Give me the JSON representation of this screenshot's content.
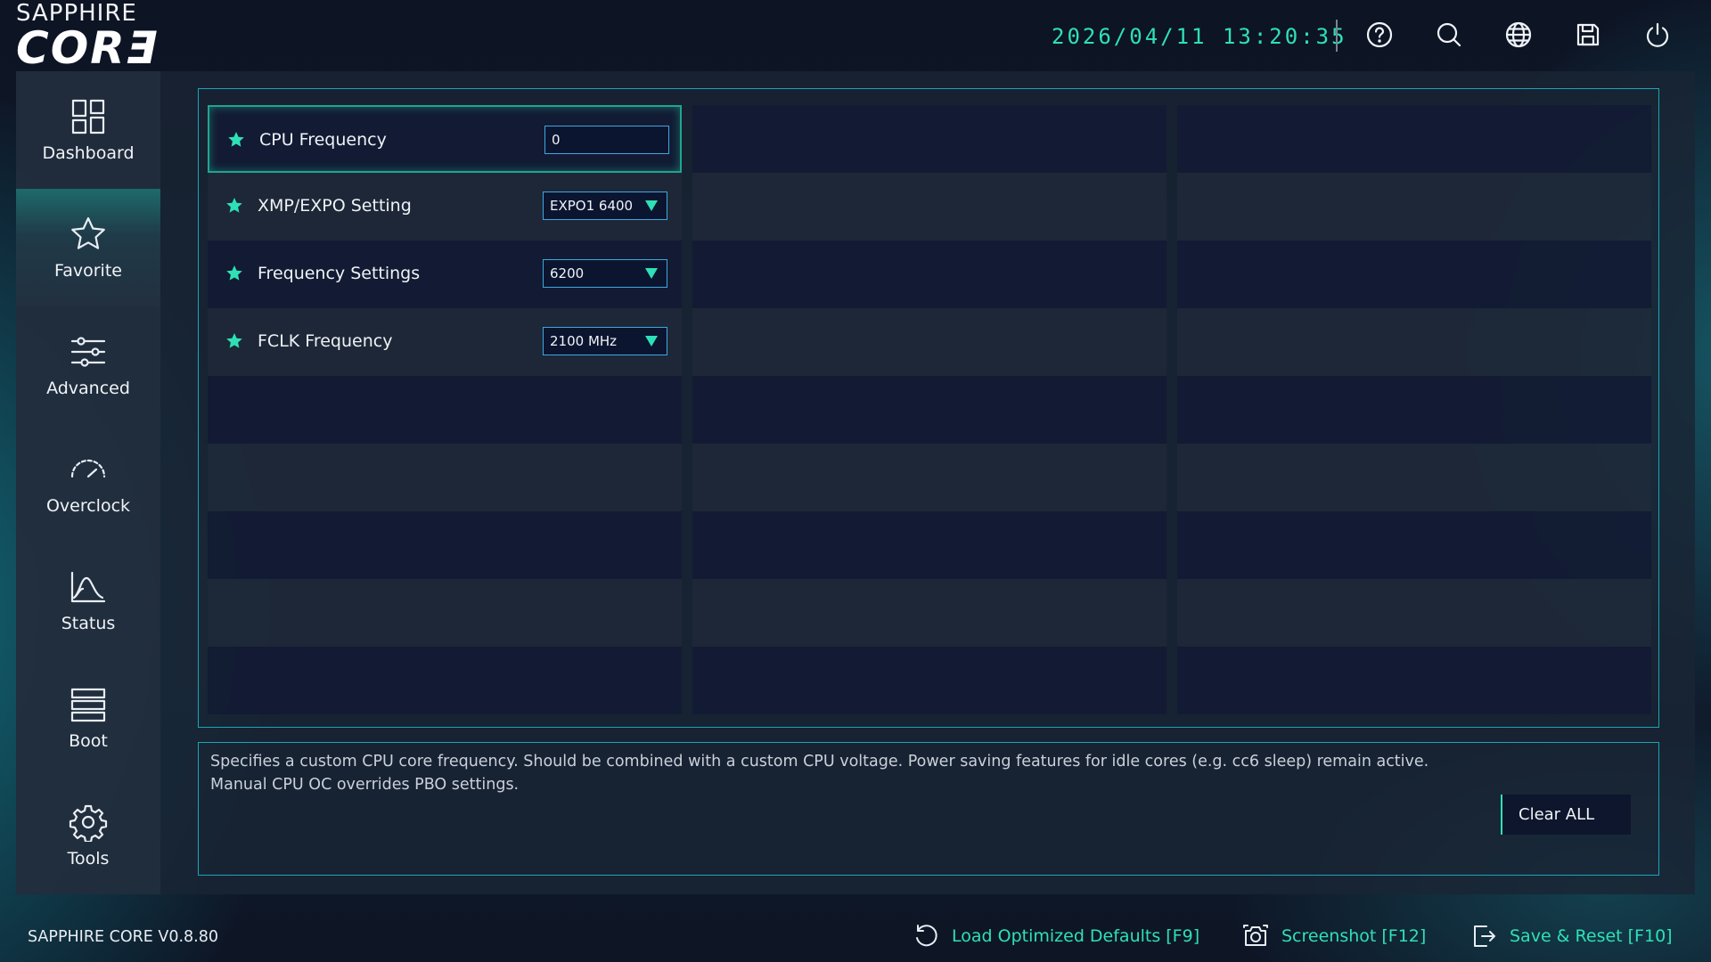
{
  "brand": {
    "top": "SAPPHIRE",
    "main": "CORƎ"
  },
  "header": {
    "datetime": "2026/04/11 13:20:35",
    "icons": [
      "help-icon",
      "search-icon",
      "globe-icon",
      "save-icon",
      "power-icon"
    ]
  },
  "sidebar": {
    "items": [
      {
        "label": "Dashboard",
        "icon": "dashboard-icon",
        "active": false
      },
      {
        "label": "Favorite",
        "icon": "star-icon",
        "active": true
      },
      {
        "label": "Advanced",
        "icon": "sliders-icon",
        "active": false
      },
      {
        "label": "Overclock",
        "icon": "gauge-icon",
        "active": false
      },
      {
        "label": "Status",
        "icon": "chart-icon",
        "active": false
      },
      {
        "label": "Boot",
        "icon": "server-icon",
        "active": false
      },
      {
        "label": "Tools",
        "icon": "gear-icon",
        "active": false
      }
    ]
  },
  "favorites": [
    {
      "label": "CPU Frequency",
      "value": "0",
      "type": "input",
      "selected": true
    },
    {
      "label": "XMP/EXPO Setting",
      "value": "EXPO1 6400",
      "type": "select",
      "selected": false
    },
    {
      "label": "Frequency Settings",
      "value": "6200",
      "type": "select",
      "selected": false
    },
    {
      "label": "FCLK Frequency",
      "value": "2100 MHz",
      "type": "select",
      "selected": false
    }
  ],
  "description": {
    "text": "Specifies a custom CPU core frequency. Should be combined with a custom CPU voltage. Power saving features for idle cores (e.g. cc6 sleep) remain active. Manual CPU OC overrides PBO settings.",
    "clear_label": "Clear ALL"
  },
  "footer": {
    "version": "SAPPHIRE CORE V0.8.80",
    "load_defaults": "Load Optimized Defaults [F9]",
    "screenshot": "Screenshot [F12]",
    "save_reset": "Save & Reset [F10]"
  },
  "colors": {
    "accent": "#2fe0b6",
    "frame": "#1aa5b5",
    "input_border": "#3ea7e0"
  }
}
